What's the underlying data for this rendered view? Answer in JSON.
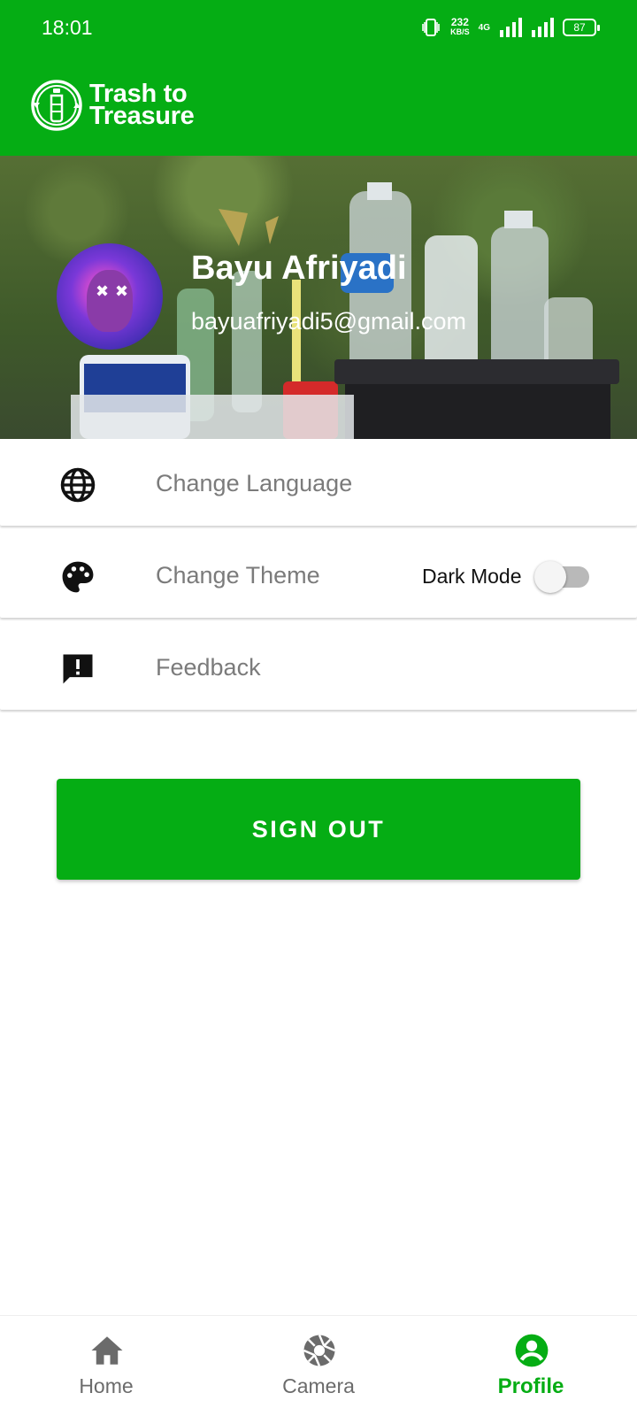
{
  "status_bar": {
    "time": "18:01",
    "speed_value": "232",
    "speed_unit": "KB/S",
    "network": "4G",
    "battery": "87"
  },
  "app_bar": {
    "logo_line1": "Trash to",
    "logo_line2": "Treasure"
  },
  "profile": {
    "name": "Bayu Afriyadi",
    "email": "bayuafriyadi5@gmail.com"
  },
  "settings": {
    "language_label": "Change Language",
    "theme_label": "Change Theme",
    "dark_mode_label": "Dark Mode",
    "dark_mode_on": false,
    "feedback_label": "Feedback"
  },
  "actions": {
    "sign_out_label": "SIGN OUT"
  },
  "bottom_nav": {
    "items": [
      {
        "label": "Home",
        "icon": "home-icon",
        "active": false
      },
      {
        "label": "Camera",
        "icon": "camera-shutter-icon",
        "active": false
      },
      {
        "label": "Profile",
        "icon": "account-circle-icon",
        "active": true
      }
    ]
  },
  "colors": {
    "primary": "#05ad14",
    "text_muted": "#7b7b7b",
    "nav_inactive": "#6b6b6b"
  }
}
